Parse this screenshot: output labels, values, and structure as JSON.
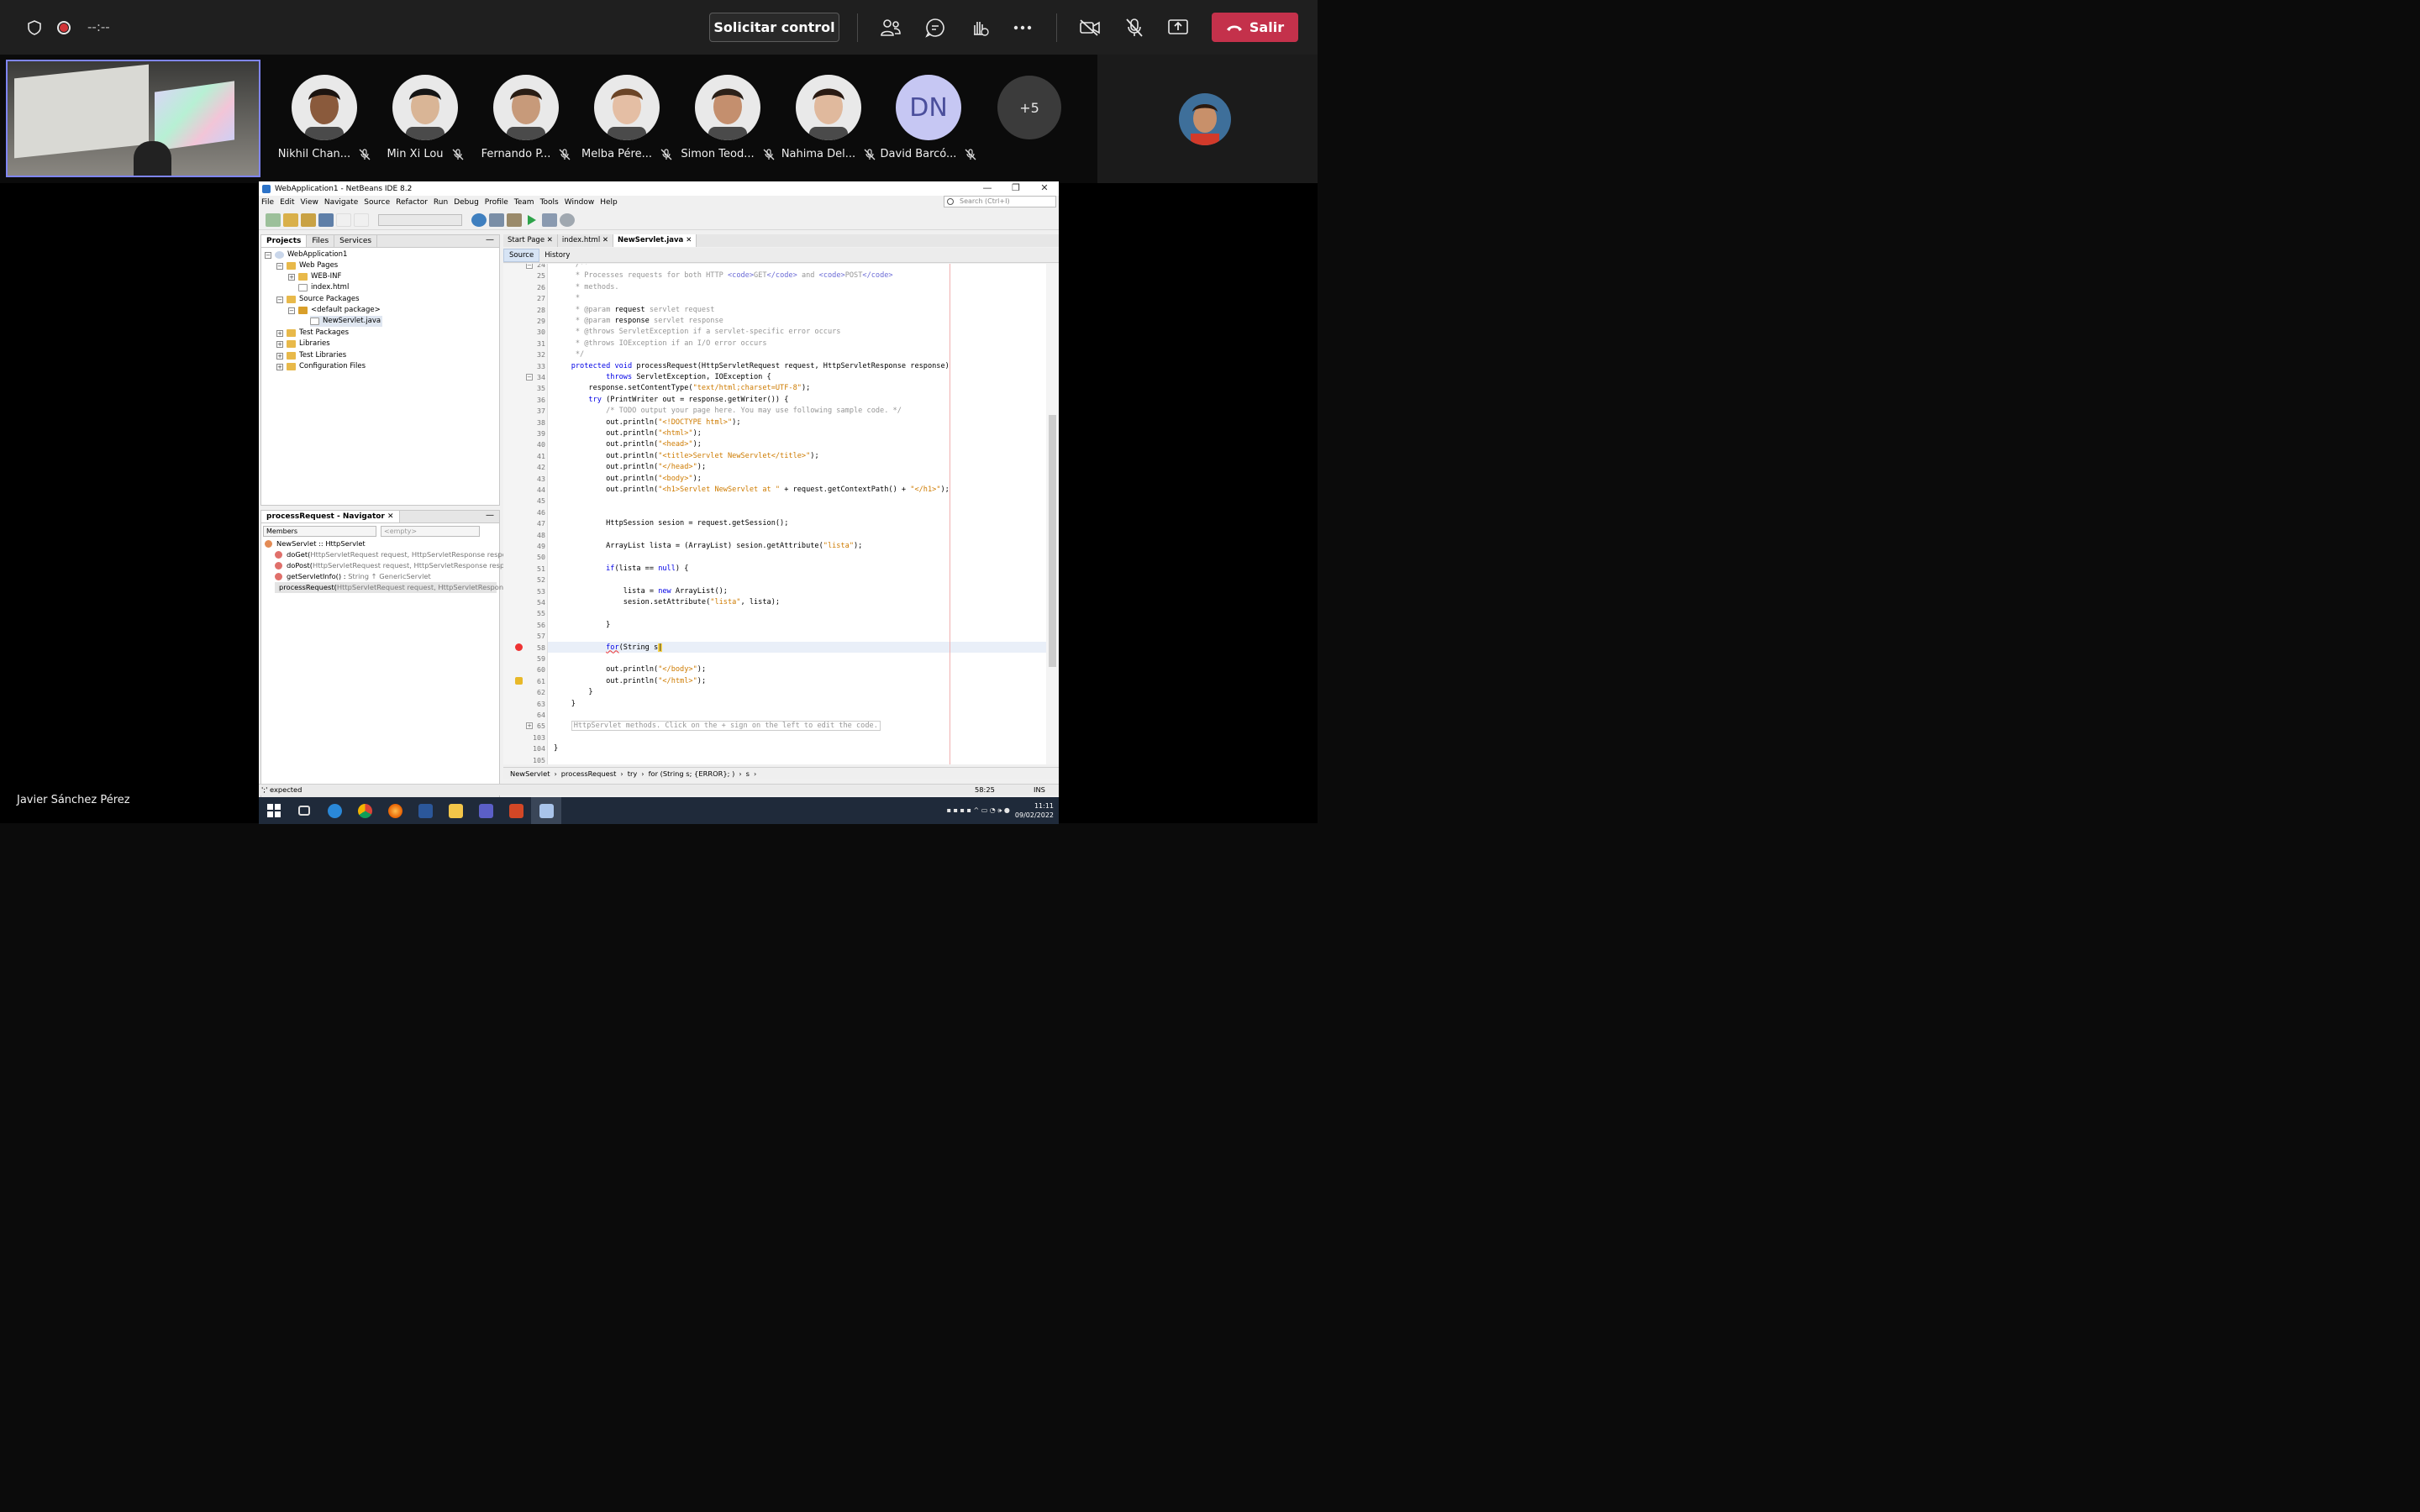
{
  "topbar": {
    "timer": "--:--",
    "request_control": "Solicitar control",
    "leave": "Salir"
  },
  "participants": [
    {
      "name": "Nikhil Chan...",
      "skin": "#8a5a3c",
      "hair": "#1c1410"
    },
    {
      "name": "Min Xi Lou",
      "skin": "#d9b596",
      "hair": "#151515"
    },
    {
      "name": "Fernando P...",
      "skin": "#c79a7a",
      "hair": "#2a1d14"
    },
    {
      "name": "Melba Pére...",
      "skin": "#e4bea4",
      "hair": "#6b4426"
    },
    {
      "name": "Simon Teod...",
      "skin": "#c48f6e",
      "hair": "#2b2018"
    },
    {
      "name": "Nahima Del...",
      "skin": "#e0b99d",
      "hair": "#2a1a12"
    },
    {
      "name": "David Barcó...",
      "initials": "DN"
    }
  ],
  "more_count": "+5",
  "presenter_name": "Javier Sánchez Pérez",
  "netbeans": {
    "title": "WebApplication1 - NetBeans IDE 8.2",
    "menu": [
      "File",
      "Edit",
      "View",
      "Navigate",
      "Source",
      "Refactor",
      "Run",
      "Debug",
      "Profile",
      "Team",
      "Tools",
      "Window",
      "Help"
    ],
    "search_placeholder": "Search (Ctrl+I)",
    "project_tabs": [
      "Projects",
      "Files",
      "Services"
    ],
    "tree": [
      {
        "label": "WebApplication1"
      },
      {
        "label": "Web Pages"
      },
      {
        "label": "WEB-INF"
      },
      {
        "label": "index.html"
      },
      {
        "label": "Source Packages"
      },
      {
        "label": "<default package>"
      },
      {
        "label": "NewServlet.java"
      },
      {
        "label": "Test Packages"
      },
      {
        "label": "Libraries"
      },
      {
        "label": "Test Libraries"
      },
      {
        "label": "Configuration Files"
      }
    ],
    "navigator": {
      "title": "processRequest - Navigator",
      "filter": "Members",
      "empty": "<empty>",
      "class_row": "NewServlet :: HttpServlet",
      "members": [
        {
          "name": "doGet(",
          "args": "HttpServletRequest request, HttpServletResponse response)"
        },
        {
          "name": "doPost(",
          "args": "HttpServletRequest request, HttpServletResponse response)"
        },
        {
          "name": "getServletInfo() : ",
          "args": "String ↑ GenericServlet"
        },
        {
          "name": "processRequest(",
          "args": "HttpServletRequest request, HttpServletResponse re"
        }
      ]
    },
    "editor_tabs": [
      "Start Page",
      "index.html",
      "NewServlet.java"
    ],
    "source_label": "Source",
    "history_label": "History",
    "line_numbers": [
      "24",
      "25",
      "26",
      "27",
      "28",
      "29",
      "30",
      "31",
      "32",
      "33",
      "34",
      "35",
      "36",
      "37",
      "38",
      "39",
      "40",
      "41",
      "42",
      "43",
      "44",
      "45",
      "46",
      "47",
      "48",
      "49",
      "50",
      "51",
      "52",
      "53",
      "54",
      "55",
      "56",
      "57",
      "58",
      "59",
      "60",
      "61",
      "62",
      "63",
      "64",
      "65",
      "103",
      "104",
      "105"
    ],
    "breadcrumb": [
      "NewServlet",
      "processRequest",
      "try",
      "for (String s; {ERROR}; )",
      "s"
    ],
    "status_left": "';' expected",
    "status_pos": "58:25",
    "status_mode": "INS"
  },
  "taskbar": {
    "time": "11:11",
    "date": "09/02/2022"
  },
  "colors": {
    "leave_red": "#c4314b",
    "teams_bar": "#1f1f1f",
    "focus_border": "#7f85f5",
    "keyword_blue": "#0000e6",
    "string_orange": "#ce7b00"
  }
}
